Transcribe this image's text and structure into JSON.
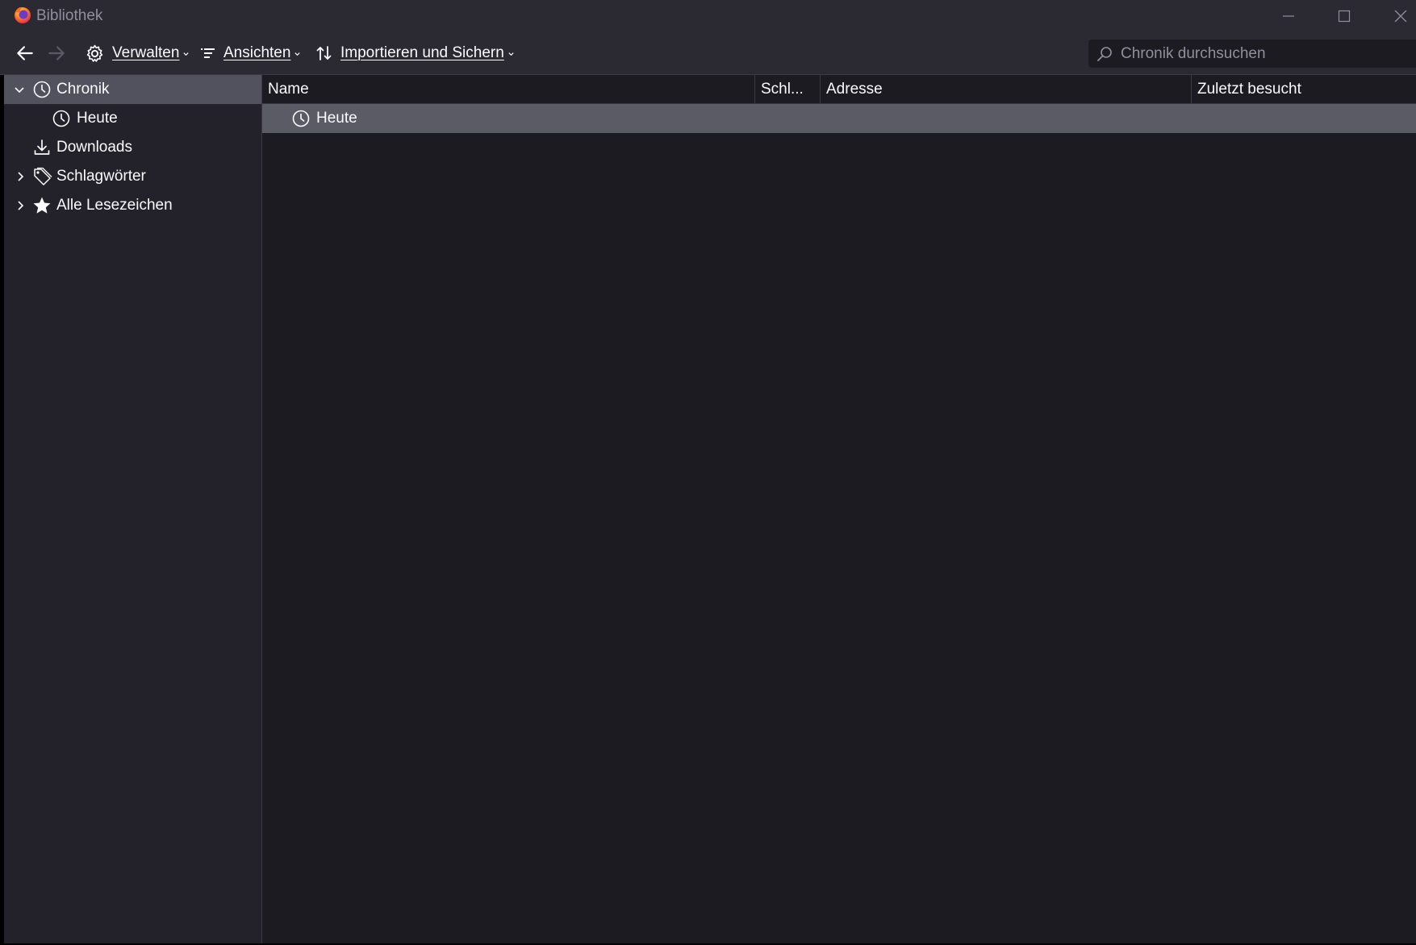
{
  "window": {
    "title": "Bibliothek",
    "app_icon": "firefox-icon",
    "controls": [
      "minimize-icon",
      "maximize-icon",
      "close-icon"
    ]
  },
  "toolbar": {
    "back_icon": "arrow-left-icon",
    "forward_icon": "arrow-right-icon",
    "manage": {
      "label": "Verwalten",
      "icon": "gear-icon"
    },
    "views": {
      "label": "Ansichten",
      "icon": "list-icon"
    },
    "import_backup": {
      "label": "Importieren und Sichern",
      "icon": "sort-arrows-icon"
    },
    "search": {
      "placeholder": "Chronik durchsuchen",
      "value": "",
      "icon": "search-icon"
    }
  },
  "sidebar": {
    "items": [
      {
        "label": "Chronik",
        "icon": "clock-icon",
        "twisty": "expanded",
        "selected": true
      },
      {
        "label": "Heute",
        "icon": "clock-icon",
        "twisty": "none"
      },
      {
        "label": "Downloads",
        "icon": "download-icon",
        "twisty": "none"
      },
      {
        "label": "Schlagwörter",
        "icon": "tag-icon",
        "twisty": "collapsed"
      },
      {
        "label": "Alle Lesezeichen",
        "icon": "star-icon",
        "twisty": "collapsed"
      }
    ]
  },
  "main": {
    "columns": [
      "Name",
      "Schl...",
      "Adresse",
      "Zuletzt besucht"
    ],
    "rows": [
      {
        "name": "Heute",
        "icon": "clock-icon",
        "selected": true
      }
    ]
  },
  "colors": {
    "background": "#1c1b22",
    "toolbar": "#2b2a33",
    "sidebar": "#23222b",
    "selection": "#5b5b66",
    "text": "#fbfbfe",
    "muted_text": "#8f8f9d"
  }
}
